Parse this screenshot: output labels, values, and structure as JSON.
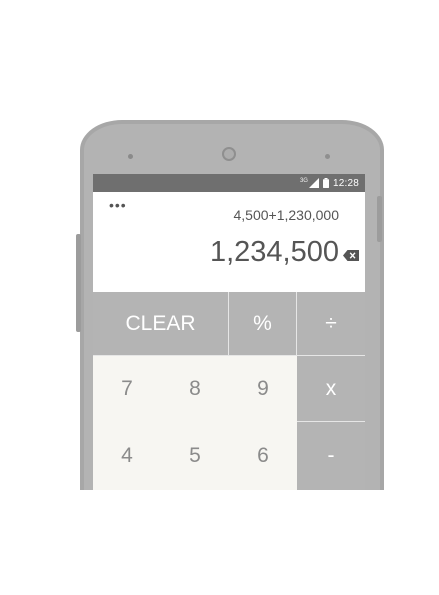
{
  "status_bar": {
    "network_label": "3G",
    "time": "12:28"
  },
  "display": {
    "menu_icon": "more-horiz-icon",
    "expression": "4,500+1,230,000",
    "result": "1,234,500",
    "backspace_icon": "backspace-icon"
  },
  "keypad": {
    "clear": "CLEAR",
    "percent": "%",
    "divide": "÷",
    "seven": "7",
    "eight": "8",
    "nine": "9",
    "multiply": "x",
    "four": "4",
    "five": "5",
    "six": "6",
    "subtract": "-"
  },
  "colors": {
    "phone_body": "#a7a7a7",
    "status_bar": "#6f6f6f",
    "operator_key": "#b4b4b4",
    "number_key": "#f7f6f2",
    "display_text": "#555555"
  }
}
